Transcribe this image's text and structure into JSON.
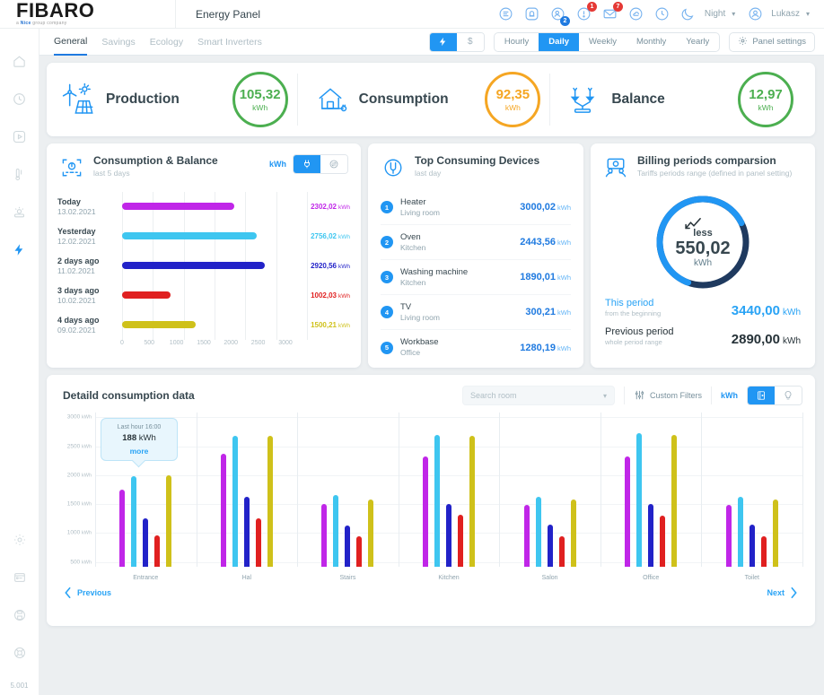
{
  "header": {
    "logo": "FIBARO",
    "logo_sub_pre": "a ",
    "logo_sub_brand": "Nice",
    "logo_sub_post": " group company",
    "page_title": "Energy Panel",
    "icons": [
      {
        "name": "list-icon",
        "badge": null
      },
      {
        "name": "alarm-icon",
        "badge": null
      },
      {
        "name": "users-icon",
        "badge": "2",
        "badge_color": "blue"
      },
      {
        "name": "alert-icon",
        "badge": "1",
        "badge_color": "red"
      },
      {
        "name": "mail-icon",
        "badge": "7",
        "badge_color": "red"
      },
      {
        "name": "cloud-icon",
        "badge": null
      },
      {
        "name": "clock-icon",
        "badge": null
      }
    ],
    "night_label": "Night",
    "user_label": "Lukasz"
  },
  "nav": {
    "tabs": [
      {
        "label": "General",
        "active": true
      },
      {
        "label": "Savings",
        "active": false
      },
      {
        "label": "Ecology",
        "active": false
      },
      {
        "label": "Smart Inverters",
        "active": false
      }
    ],
    "unit_toggle": [
      {
        "name": "energy-icon",
        "glyph": "⚡",
        "active": true
      },
      {
        "name": "currency-icon",
        "glyph": "$",
        "active": false
      }
    ],
    "periods": [
      {
        "label": "Hourly",
        "active": false
      },
      {
        "label": "Daily",
        "active": true
      },
      {
        "label": "Weekly",
        "active": false
      },
      {
        "label": "Monthly",
        "active": false
      },
      {
        "label": "Yearly",
        "active": false
      }
    ],
    "settings_label": "Panel settings"
  },
  "sidebar": {
    "items": [
      {
        "name": "home-icon",
        "active": false
      },
      {
        "name": "history-icon",
        "active": false
      },
      {
        "name": "scenes-icon",
        "active": false
      },
      {
        "name": "devices-icon",
        "active": false
      },
      {
        "name": "climate-icon",
        "active": false
      },
      {
        "name": "energy-icon",
        "active": true
      }
    ],
    "bottom_items": [
      {
        "name": "settings-gear-icon"
      },
      {
        "name": "panels-icon"
      },
      {
        "name": "save-icon"
      },
      {
        "name": "support-icon"
      }
    ],
    "version": "5.001"
  },
  "summary": {
    "items": [
      {
        "icon": "solar-wind-icon",
        "label": "Production",
        "value": "105,32",
        "unit": "kWh",
        "color": "green"
      },
      {
        "icon": "house-plug-icon",
        "label": "Consumption",
        "value": "92,35",
        "unit": "kWh",
        "color": "orange"
      },
      {
        "icon": "balance-scale-icon",
        "label": "Balance",
        "value": "12,97",
        "unit": "kWh",
        "color": "green"
      }
    ]
  },
  "chart_data": [
    {
      "type": "bar",
      "orientation": "horizontal",
      "title": "Consumption & Balance",
      "subtitle": "last 5 days",
      "unit": "kWh",
      "xlabel": "",
      "ylabel": "",
      "xlim": [
        0,
        3000
      ],
      "ticks": [
        0,
        500,
        1000,
        1500,
        2000,
        2500,
        3000
      ],
      "tick_labels": [
        "0",
        "500",
        "1000",
        "1500",
        "2000",
        "2500",
        "3000"
      ],
      "grid": true,
      "categories": [
        "Today",
        "Yesterday",
        "2 days ago",
        "3 days ago",
        "4 days ago"
      ],
      "category_dates": [
        "13.02.2021",
        "12.02.2021",
        "11.02.2021",
        "10.02.2021",
        "09.02.2021"
      ],
      "values": [
        2302.02,
        2756.02,
        2920.56,
        1002.03,
        1500.21
      ],
      "value_labels": [
        "2302,02",
        "2756,02",
        "2920,56",
        "1002,03",
        "1500,21"
      ],
      "colors": [
        "#c026e8",
        "#3ec6f0",
        "#2222c8",
        "#e02020",
        "#cfc11a"
      ]
    },
    {
      "type": "bar",
      "title": "Detaild consumption data",
      "unit": "kWh",
      "ylim": [
        0,
        3200
      ],
      "yticks": [
        500,
        1000,
        1500,
        2000,
        2500,
        3000
      ],
      "ytick_labels": [
        "500",
        "1000",
        "1500",
        "2000",
        "2500",
        "3000"
      ],
      "ytick_unit": "kWh",
      "grid": true,
      "categories": [
        "Entrance",
        "Hal",
        "Stairs",
        "Kitchen",
        "Salon",
        "Office",
        "Toilet"
      ],
      "series": [
        {
          "name": "series-1",
          "color": "#c026e8",
          "values": [
            1600,
            2340,
            1300,
            2290,
            1290,
            2290,
            1290
          ]
        },
        {
          "name": "series-2",
          "color": "#3ec6f0",
          "values": [
            1880,
            2720,
            1480,
            2740,
            1450,
            2780,
            1450
          ]
        },
        {
          "name": "series-3",
          "color": "#2222c8",
          "values": [
            1000,
            1450,
            860,
            1300,
            880,
            1300,
            880
          ]
        },
        {
          "name": "series-4",
          "color": "#e02020",
          "values": [
            660,
            1000,
            640,
            1080,
            630,
            1060,
            630
          ]
        },
        {
          "name": "series-5",
          "color": "#cfc11a",
          "values": [
            1890,
            2720,
            1400,
            2720,
            1400,
            2740,
            1400
          ]
        }
      ],
      "tooltip": {
        "title": "Last hour 16:00",
        "value": "188",
        "unit": "kWh",
        "link": "more"
      }
    }
  ],
  "consumption_balance": {
    "title": "Consumption & Balance",
    "subtitle": "last 5 days",
    "unit_label": "kWh",
    "toggle": [
      {
        "name": "plug-icon",
        "active": true
      },
      {
        "name": "exchange-icon",
        "active": false
      }
    ]
  },
  "top_devices": {
    "title": "Top Consuming Devices",
    "subtitle": "last day",
    "unit": "kWh",
    "items": [
      {
        "rank": "1",
        "name": "Heater",
        "room": "Living room",
        "value": "3000,02"
      },
      {
        "rank": "2",
        "name": "Oven",
        "room": "Kitchen",
        "value": "2443,56"
      },
      {
        "rank": "3",
        "name": "Washing machine",
        "room": "Kitchen",
        "value": "1890,01"
      },
      {
        "rank": "4",
        "name": "TV",
        "room": "Living room",
        "value": "300,21"
      },
      {
        "rank": "5",
        "name": "Workbase",
        "room": "Office",
        "value": "1280,19"
      }
    ]
  },
  "billing": {
    "title": "Billing periods comparsion",
    "subtitle": "Tariffs periods range (defined in panel setting)",
    "donut": {
      "caption": "less",
      "value": "550,02",
      "unit": "kWh",
      "percent": 62,
      "track_color": "#1f3a5f",
      "fill_color": "#2196f3"
    },
    "rows": [
      {
        "label": "This period",
        "sub": "from the beginning",
        "amount": "3440,00",
        "unit": "kWh",
        "color": "blue"
      },
      {
        "label": "Previous period",
        "sub": "whole period range",
        "amount": "2890,00",
        "unit": "kWh",
        "color": "dark"
      }
    ]
  },
  "detailed": {
    "title": "Detaild consumption data",
    "search_placeholder": "Search room",
    "filters_label": "Custom Filters",
    "unit_label": "kWh",
    "view_toggle": [
      {
        "name": "rooms-view-icon",
        "active": true
      },
      {
        "name": "devices-view-icon",
        "active": false
      }
    ],
    "prev_label": "Previous",
    "next_label": "Next"
  }
}
